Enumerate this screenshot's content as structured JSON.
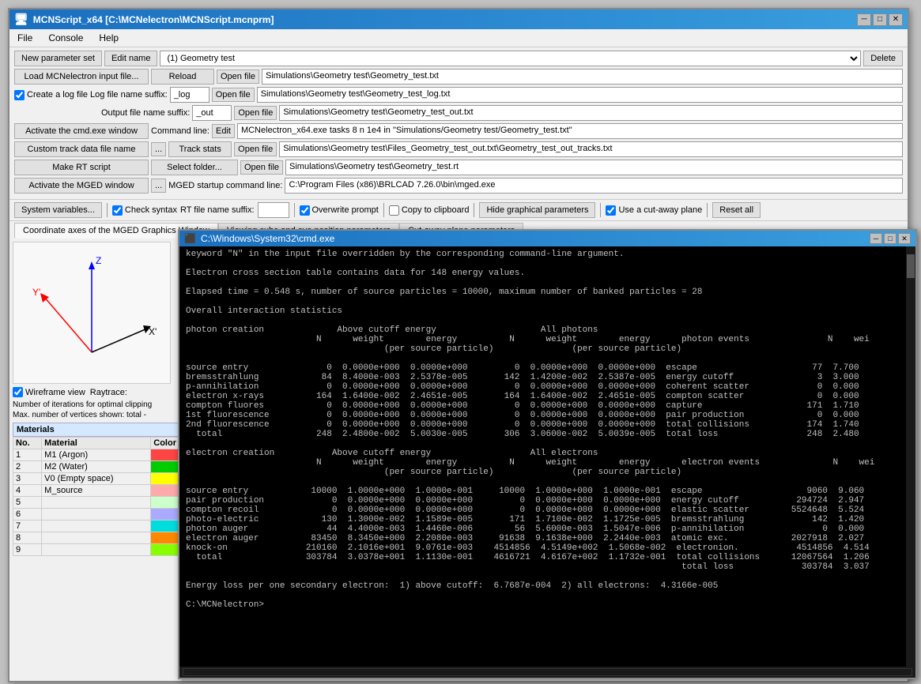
{
  "app": {
    "title": "MCNScript_x64 [C:\\MCNelectron\\MCNScript.mcnprm]",
    "icon": "🖥"
  },
  "menu": {
    "items": [
      "File",
      "Console",
      "Help"
    ]
  },
  "toolbar": {
    "new_param_set": "New parameter set",
    "edit_name": "Edit name",
    "load_input": "Load MCNelectron input file...",
    "reload": "Reload",
    "open_file1": "Open file",
    "create_log_label": "Create a log file",
    "log_suffix_label": "Log file name suffix:",
    "log_suffix_val": "_log",
    "open_file2": "Open file",
    "output_suffix_label": "Output file name suffix:",
    "output_suffix_val": "_out",
    "open_file3": "Open file",
    "activate_cmd": "Activate the cmd.exe window",
    "command_line_label": "Command line:",
    "edit_btn": "Edit",
    "custom_track": "Custom track data file name",
    "ellipsis1": "...",
    "track_stats": "Track stats",
    "open_file4": "Open file",
    "make_rt_script": "Make RT script",
    "select_folder": "Select folder...",
    "open_file5": "Open file",
    "activate_mged": "Activate the MGED window",
    "ellipsis2": "...",
    "mged_label": "MGED startup command line:",
    "system_vars": "System variables...",
    "check_syntax": "Check syntax",
    "rt_suffix_label": "RT file name suffix:",
    "overwrite_prompt": "Overwrite prompt",
    "copy_clipboard": "Copy to clipboard",
    "hide_graphical": "Hide graphical parameters",
    "use_cutaway": "Use a cut-away plane",
    "reset_all": "Reset all",
    "delete_btn": "Delete",
    "dropdown_val": "(1) Geometry test",
    "path1": "Simulations\\Geometry test\\Geometry_test.txt",
    "path2": "Simulations\\Geometry test\\Geometry_test_log.txt",
    "path3": "Simulations\\Geometry test\\Geometry_test_out.txt",
    "command_val": "MCNelectron_x64.exe tasks 8 n 1e4 in \"Simulations/Geometry test/Geometry_test.txt\"",
    "path4": "Simulations\\Geometry test\\Files_Geometry_test_out.txt\\Geometry_test_out_tracks.txt",
    "path5": "Simulations\\Geometry test\\Geometry_test.rt",
    "mged_path": "C:\\Program Files (x86)\\BRLCAD 7.26.0\\bin\\mged.exe"
  },
  "tabs": {
    "tab1": "Coordinate axes of the MGED Graphics Window",
    "tab2": "Viewing cube and eye position parameters",
    "tab3": "Cut-away plane parameters"
  },
  "left_panel": {
    "wireframe_label": "Wireframe view",
    "raytrace_label": "Raytrace:",
    "iterations_label": "Number of iterations for optimal clipping",
    "max_vertices_label": "Max. number of vertices shown: total -",
    "materials_header": "Materials",
    "materials_cols": [
      "No.",
      "Material",
      "Color"
    ],
    "materials": [
      {
        "no": "1",
        "name": "M1 (Argon)",
        "color": "#ff4444"
      },
      {
        "no": "2",
        "name": "M2 (Water)",
        "color": "#00cc00"
      },
      {
        "no": "3",
        "name": "V0 (Empty space)",
        "color": "#ffff00"
      },
      {
        "no": "4",
        "name": "M_source",
        "color": "#ffaaaa"
      },
      {
        "no": "5",
        "name": "",
        "color": "#ccffcc"
      },
      {
        "no": "6",
        "name": "",
        "color": "#aaaaff"
      },
      {
        "no": "7",
        "name": "",
        "color": "#00dddd"
      },
      {
        "no": "8",
        "name": "",
        "color": "#ff8800"
      },
      {
        "no": "9",
        "name": "",
        "color": "#88ff00"
      }
    ]
  },
  "cmd": {
    "title": "C:\\Windows\\System32\\cmd.exe",
    "content_lines": [
      "keyword \"N\" in the input file overridden by the corresponding command-line argument.",
      "",
      "Electron cross section table contains data for 148 energy values.",
      "",
      "Elapsed time = 0.548 s, number of source particles = 10000, maximum number of banked particles = 28",
      "",
      "Overall interaction statistics",
      "",
      "photon creation              Above cutoff energy                    All photons",
      "                         N      weight        energy          N      weight        energy      photon events               N    wei",
      "                                      (per source particle)               (per source particle)",
      "",
      "source entry               0  0.0000e+000  0.0000e+000         0  0.0000e+000  0.0000e+000  escape                      77  7.700",
      "bremsstrahlung            84  8.4000e-003  2.5378e-005       142  1.4200e-002  2.5387e-005  energy cutoff                3  3.000",
      "p-annihilation             0  0.0000e+000  0.0000e+000         0  0.0000e+000  0.0000e+000  coherent scatter             0  0.000",
      "electron x-rays          164  1.6400e-002  2.4651e-005       164  1.6400e-002  2.4651e-005  compton scatter              0  0.000",
      "compton fluores            0  0.0000e+000  0.0000e+000         0  0.0000e+000  0.0000e+000  capture                    171  1.710",
      "1st fluorescence           0  0.0000e+000  0.0000e+000         0  0.0000e+000  0.0000e+000  pair production              0  0.000",
      "2nd fluorescence           0  0.0000e+000  0.0000e+000         0  0.0000e+000  0.0000e+000  total collisions           174  1.740",
      "  total                  248  2.4800e-002  5.0030e-005       306  3.0600e-002  5.0039e-005  total loss                 248  2.480",
      "",
      "electron creation           Above cutoff energy                   All electrons",
      "                         N      weight        energy          N      weight        energy      electron events              N    wei",
      "                                      (per source particle)               (per source particle)",
      "",
      "source entry            10000  1.0000e+000  1.0000e-001     10000  1.0000e+000  1.0000e-001  escape                    9060  9.060",
      "pair production             0  0.0000e+000  0.0000e+000         0  0.0000e+000  0.0000e+000  energy cutoff           294724  2.947",
      "compton recoil              0  0.0000e+000  0.0000e+000         0  0.0000e+000  0.0000e+000  elastic scatter        5524648  5.524",
      "photo-electric            130  1.3000e-002  1.1589e-005       171  1.7100e-002  1.1725e-005  bremsstrahlung             142  1.420",
      "photon auger               44  4.4000e-003  1.4460e-006        56  5.6000e-003  1.5047e-006  p-annihilation               0  0.000",
      "electron auger          83450  8.3450e+000  2.2080e-003     91638  9.1638e+000  2.2440e-003  atomic exc.            2027918  2.027",
      "knock-on               210160  2.1016e+001  9.0761e-003    4514856  4.5149e+002  1.5068e-002  electronion.           4514856  4.514",
      "  total                303784  3.0378e+001  1.1130e-001    4616721  4.6167e+002  1.1732e-001  total collisions      12067564  1.206",
      "                                                                                               total loss             303784  3.037",
      "",
      "Energy loss per one secondary electron:  1) above cutoff:  6.7687e-004  2) all electrons:  4.3166e-005",
      "",
      "C:\\MCNelectron>"
    ]
  }
}
